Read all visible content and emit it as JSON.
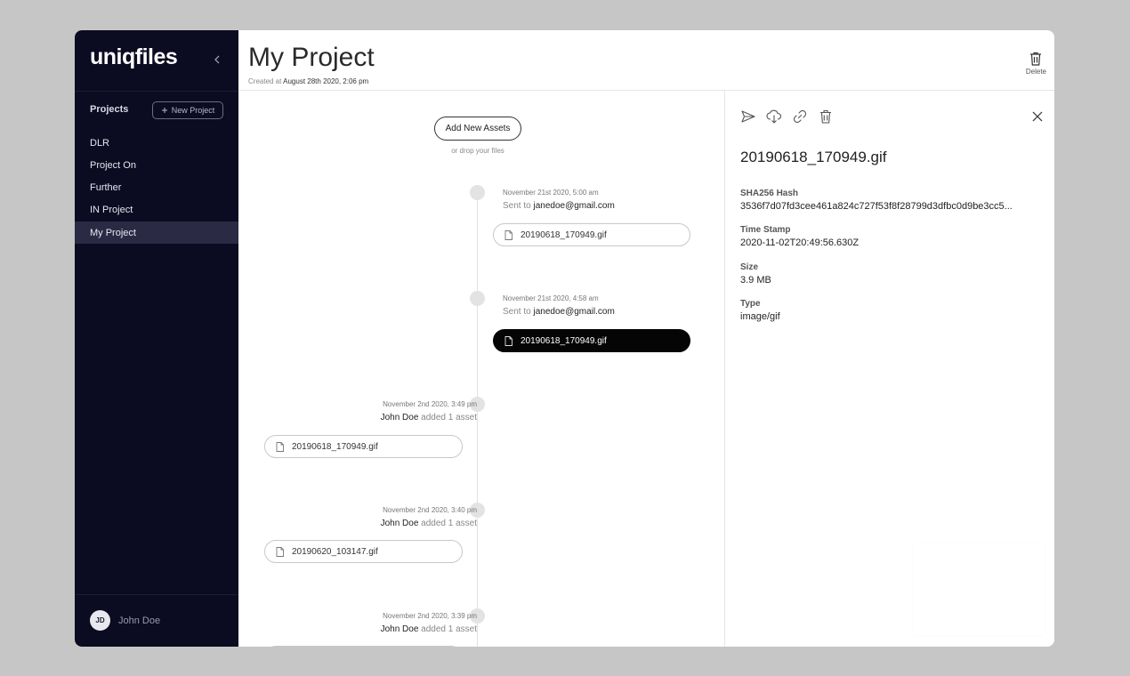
{
  "app": {
    "logo": "uniqfiles"
  },
  "sidebar": {
    "projects_label": "Projects",
    "new_project_label": "New Project",
    "items": [
      {
        "label": "DLR"
      },
      {
        "label": "Project On"
      },
      {
        "label": "Further"
      },
      {
        "label": "IN Project"
      },
      {
        "label": "My Project",
        "active": true
      }
    ],
    "user": {
      "initials": "JD",
      "name": "John Doe"
    }
  },
  "header": {
    "title": "My Project",
    "created_prefix": "Created at",
    "created_value": "August 28th 2020, 2:06 pm",
    "delete_label": "Delete"
  },
  "timeline": {
    "add_assets_label": "Add New Assets",
    "drop_hint": "or drop your files",
    "events": [
      {
        "date": "November 21st 2020, 5:00 am",
        "prefix": "Sent to",
        "actor": "janedoe@gmail.com",
        "file": "20190618_170949.gif",
        "side": "right"
      },
      {
        "date": "November 21st 2020, 4:58 am",
        "prefix": "Sent to",
        "actor": "janedoe@gmail.com",
        "file": "20190618_170949.gif",
        "side": "right",
        "selected": true
      },
      {
        "date": "November 2nd 2020, 3:49 pm",
        "actor": "John Doe",
        "suffix": "added 1 asset",
        "file": "20190618_170949.gif",
        "side": "left"
      },
      {
        "date": "November 2nd 2020, 3:40 pm",
        "actor": "John Doe",
        "suffix": "added 1 asset",
        "file": "20190620_103147.gif",
        "side": "left"
      },
      {
        "date": "November 2nd 2020, 3:39 pm",
        "actor": "John Doe",
        "suffix": "added 1 asset",
        "side": "left"
      }
    ]
  },
  "details": {
    "file_name": "20190618_170949.gif",
    "fields": [
      {
        "label": "SHA256 Hash",
        "value": "3536f7d07fd3cee461a824c727f53f8f28799d3dfbc0d9be3cc5..."
      },
      {
        "label": "Time Stamp",
        "value": "2020-11-02T20:49:56.630Z"
      },
      {
        "label": "Size",
        "value": "3.9 MB"
      },
      {
        "label": "Type",
        "value": "image/gif"
      }
    ],
    "tools": [
      "send-icon",
      "cloud-download-icon",
      "link-icon",
      "trash-icon"
    ]
  }
}
